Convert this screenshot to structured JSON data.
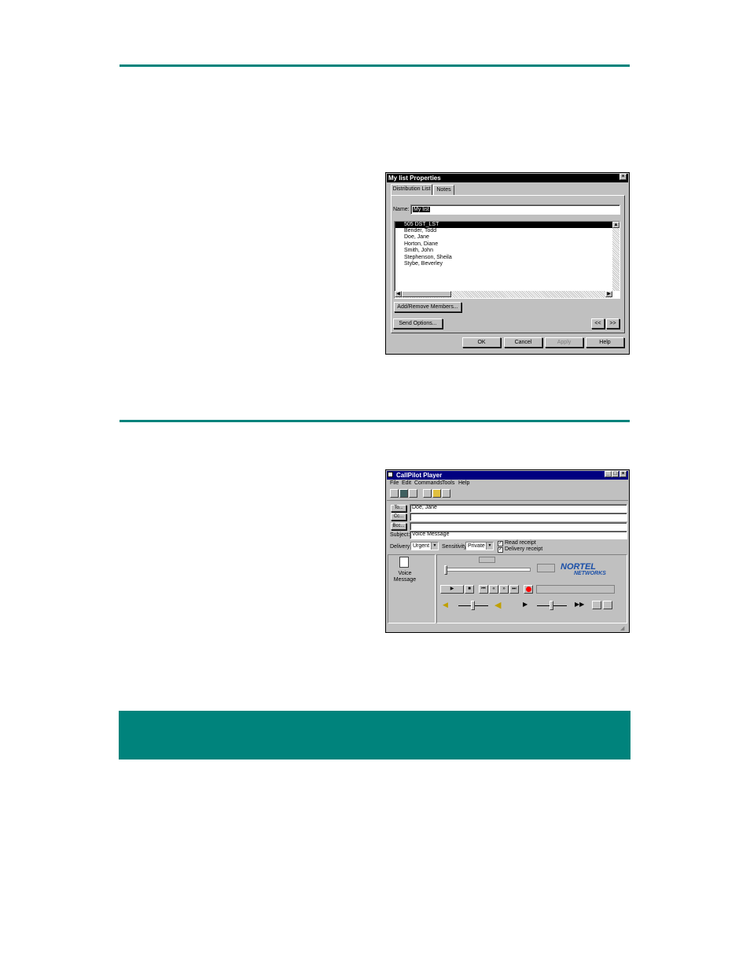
{
  "distribution_dialog": {
    "title": "My list Properties",
    "close_glyph": "×",
    "tabs": [
      "Distribution List",
      "Notes"
    ],
    "name_label": "Name:",
    "name_value": "My list",
    "members": [
      "505 DST_LST",
      "Bender, Todd",
      "Doe, Jane",
      "Horton, Diane",
      "Smith, John",
      "Stephenson, Sheila",
      "Stybe, Beverley"
    ],
    "add_remove_button": "Add/Remove Members...",
    "send_options_button": "Send Options...",
    "prev_button": "<<",
    "next_button": ">>",
    "ok_button": "OK",
    "cancel_button": "Cancel",
    "apply_button": "Apply",
    "help_button": "Help"
  },
  "player_window": {
    "title": "CallPilot Player",
    "menu": [
      "File",
      "Edit",
      "Commands",
      "Tools",
      "Help"
    ],
    "to_label": "To...",
    "cc_label": "Cc...",
    "bcc_label": "Bcc...",
    "to_value": "Doe, Jane",
    "cc_value": "",
    "bcc_value": "",
    "subject_label": "Subject:",
    "subject_value": "Voice Message",
    "delivery_label": "Delivery:",
    "delivery_value": "Urgent",
    "sensitivity_label": "Sensitivity:",
    "sensitivity_value": "Private",
    "read_receipt_label": "Read receipt",
    "read_receipt_checked": true,
    "delivery_receipt_label": "Delivery receipt",
    "delivery_receipt_checked": true,
    "attachment_label": "Voice Message",
    "logo_line1": "NORTEL",
    "logo_line2": "NETWORKS",
    "record_color": "#ff0000",
    "logo_color": "#1a4fa8"
  },
  "colors": {
    "accent_teal": "#00837c"
  }
}
